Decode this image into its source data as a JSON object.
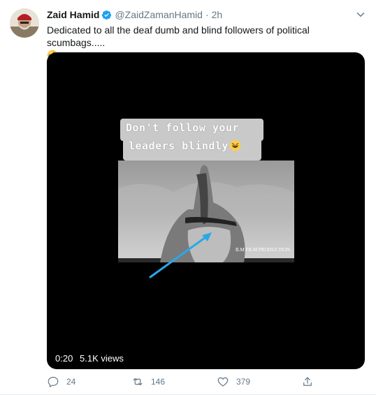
{
  "tweet": {
    "name": "Zaid Hamid",
    "handle": "@ZaidZamanHamid",
    "separator": "·",
    "time": "2h",
    "text": "Dedicated to all the deaf dumb and blind followers of political scumbags.....",
    "text_emoji": "rolling-on-floor-laughing-emoji"
  },
  "media": {
    "caption_line1": "Don't follow your",
    "caption_line2": "leaders blindly",
    "caption_emoji": "grinning-squinting-emoji",
    "watermark": "B.M FILM PRODUCTION.",
    "duration": "0:20",
    "views": "5.1K views"
  },
  "actions": {
    "replies": "24",
    "retweets": "146",
    "likes": "379"
  },
  "icons": {
    "verified": "verified-badge-icon",
    "caret": "chevron-down-icon",
    "reply": "reply-icon",
    "retweet": "retweet-icon",
    "like": "heart-icon",
    "share": "share-icon"
  },
  "colors": {
    "verified": "#1da1f2",
    "secondary_text": "#657786",
    "media_bg": "#000000",
    "arrow": "#29a8e8"
  }
}
